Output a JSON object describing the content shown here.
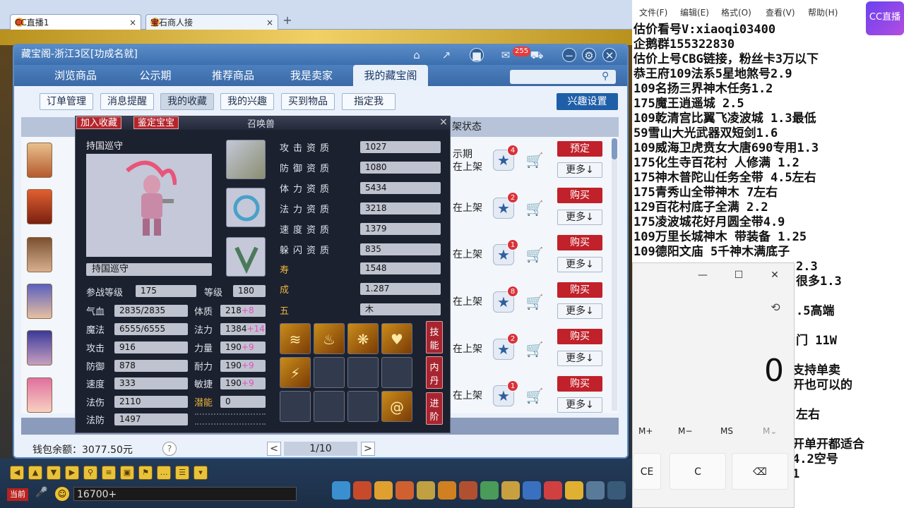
{
  "browser": {
    "tabs": [
      {
        "label": "CC直播1",
        "close": "×"
      },
      {
        "label": "宝石商人接",
        "close": "×"
      }
    ],
    "new_tab": "+"
  },
  "window": {
    "title": "藏宝阁-浙江3区[功成名就]",
    "notify_count": "255",
    "nav": [
      "浏览商品",
      "公示期",
      "推荐商品",
      "我是卖家",
      "我的藏宝阁"
    ],
    "nav_active": 4,
    "subtabs": [
      "订单管理",
      "消息提醒",
      "我的收藏",
      "我的兴趣",
      "买到物品",
      "指定我"
    ],
    "subtab_active": 2,
    "interest_settings": "兴趣设置",
    "status_header": "架状态"
  },
  "rows": [
    {
      "status": [
        "示期",
        "在上架"
      ],
      "badge": "4",
      "action": "预定",
      "more": "更多↓"
    },
    {
      "status": [
        "在上架"
      ],
      "badge": "2",
      "action": "购买",
      "more": "更多↓"
    },
    {
      "status": [
        "在上架"
      ],
      "badge": "1",
      "action": "购买",
      "more": "更多↓"
    },
    {
      "status": [
        "在上架"
      ],
      "badge": "8",
      "action": "购买",
      "more": "更多↓"
    },
    {
      "status": [
        "在上架"
      ],
      "badge": "2",
      "action": "购买",
      "more": "更多↓"
    },
    {
      "status": [
        "在上架"
      ],
      "badge": "1",
      "action": "购买",
      "more": "更多↓"
    }
  ],
  "footer": {
    "wallet": "钱包余额：3077.50元",
    "help": "?",
    "page": "1/10",
    "prev": "<",
    "next": ">"
  },
  "pet": {
    "btn_favorite": "加入收藏",
    "btn_identify": "鉴定宝宝",
    "title": "召唤兽",
    "close": "×",
    "name": "持国巡守",
    "name_box": "持国巡守",
    "aptitudes": [
      {
        "label": "攻击资质",
        "value": "1027"
      },
      {
        "label": "防御资质",
        "value": "1080"
      },
      {
        "label": "体力资质",
        "value": "5434"
      },
      {
        "label": "法力资质",
        "value": "3218"
      },
      {
        "label": "速度资质",
        "value": "1379"
      },
      {
        "label": "躲闪资质",
        "value": "835"
      }
    ],
    "lifespan": {
      "label": "寿 命",
      "value": "1548"
    },
    "growth": {
      "label": "成 长",
      "value": "1.287"
    },
    "element": {
      "label": "五 行",
      "value": "木"
    },
    "level": {
      "label": "参战等级",
      "value": "175"
    },
    "grade": {
      "label": "等级",
      "value": "180"
    },
    "stats_left": [
      {
        "label": "气血",
        "value": "2835/2835"
      },
      {
        "label": "魔法",
        "value": "6555/6555"
      },
      {
        "label": "攻击",
        "value": "916"
      },
      {
        "label": "防御",
        "value": "878"
      },
      {
        "label": "速度",
        "value": "333"
      },
      {
        "label": "法伤",
        "value": "2110"
      },
      {
        "label": "法防",
        "value": "1497"
      }
    ],
    "stats_right": [
      {
        "label": "体质",
        "value": "218",
        "plus": "+8"
      },
      {
        "label": "法力",
        "value": "1384",
        "plus": "+14"
      },
      {
        "label": "力量",
        "value": "190",
        "plus": "+9"
      },
      {
        "label": "耐力",
        "value": "190",
        "plus": "+9"
      },
      {
        "label": "敏捷",
        "value": "190",
        "plus": "+9"
      },
      {
        "label": "潜能",
        "value": "0",
        "plus": ""
      }
    ],
    "side_buttons": [
      "技能",
      "内丹",
      "进阶"
    ]
  },
  "game": {
    "current": "当前",
    "input_value": "16700+"
  },
  "notepad": {
    "menu": [
      "文件(F)",
      "编辑(E)",
      "格式(O)",
      "查看(V)",
      "帮助(H)"
    ],
    "logo": "CC直播",
    "lines": [
      "估价看号V:xiaoqi03400",
      "企鹅群155322830",
      "估价上号CBG链接，粉丝卡3万以下",
      "恭王府109法系5星地煞号2.9",
      "109名扬三界神木任务1.2",
      "175魔王逍遥城 2.5",
      "109乾清宫比翼飞凌波城 1.3最低",
      "59雪山大光武器双短剑1.6",
      "109威海卫虎贲女大唐690专用1.3",
      "175化生寺百花村 人修满 1.2",
      "175神木普陀山任务全带 4.5左右",
      "175青秀山全带神木  7左右",
      "129百花村底子全满 2.2",
      "175凌波城花好月圆全带4.9",
      "109万里长城神木 带装备  1.25",
      "109德阳文庙 5千神木满底子"
    ],
    "tail_lines": [
      {
        "text": "2.3"
      },
      {
        "text": "很多1.3"
      },
      {
        "text": ".5高端"
      },
      {
        "text": "门 11W"
      },
      {
        "text": "支持单卖"
      },
      {
        "text": "开也可以的"
      },
      {
        "text": "左右"
      },
      {
        "text": "开单开都适合"
      },
      {
        "text": "4.2空号"
      },
      {
        "text": "1"
      }
    ]
  },
  "calculator": {
    "display": "0",
    "memory": [
      "M+",
      "M−",
      "MS",
      "M⌄"
    ],
    "keys": [
      "CE",
      "C",
      "⌫"
    ],
    "minimize": "—",
    "maximize": "☐",
    "close": "✕",
    "history_icon": "history-icon"
  }
}
